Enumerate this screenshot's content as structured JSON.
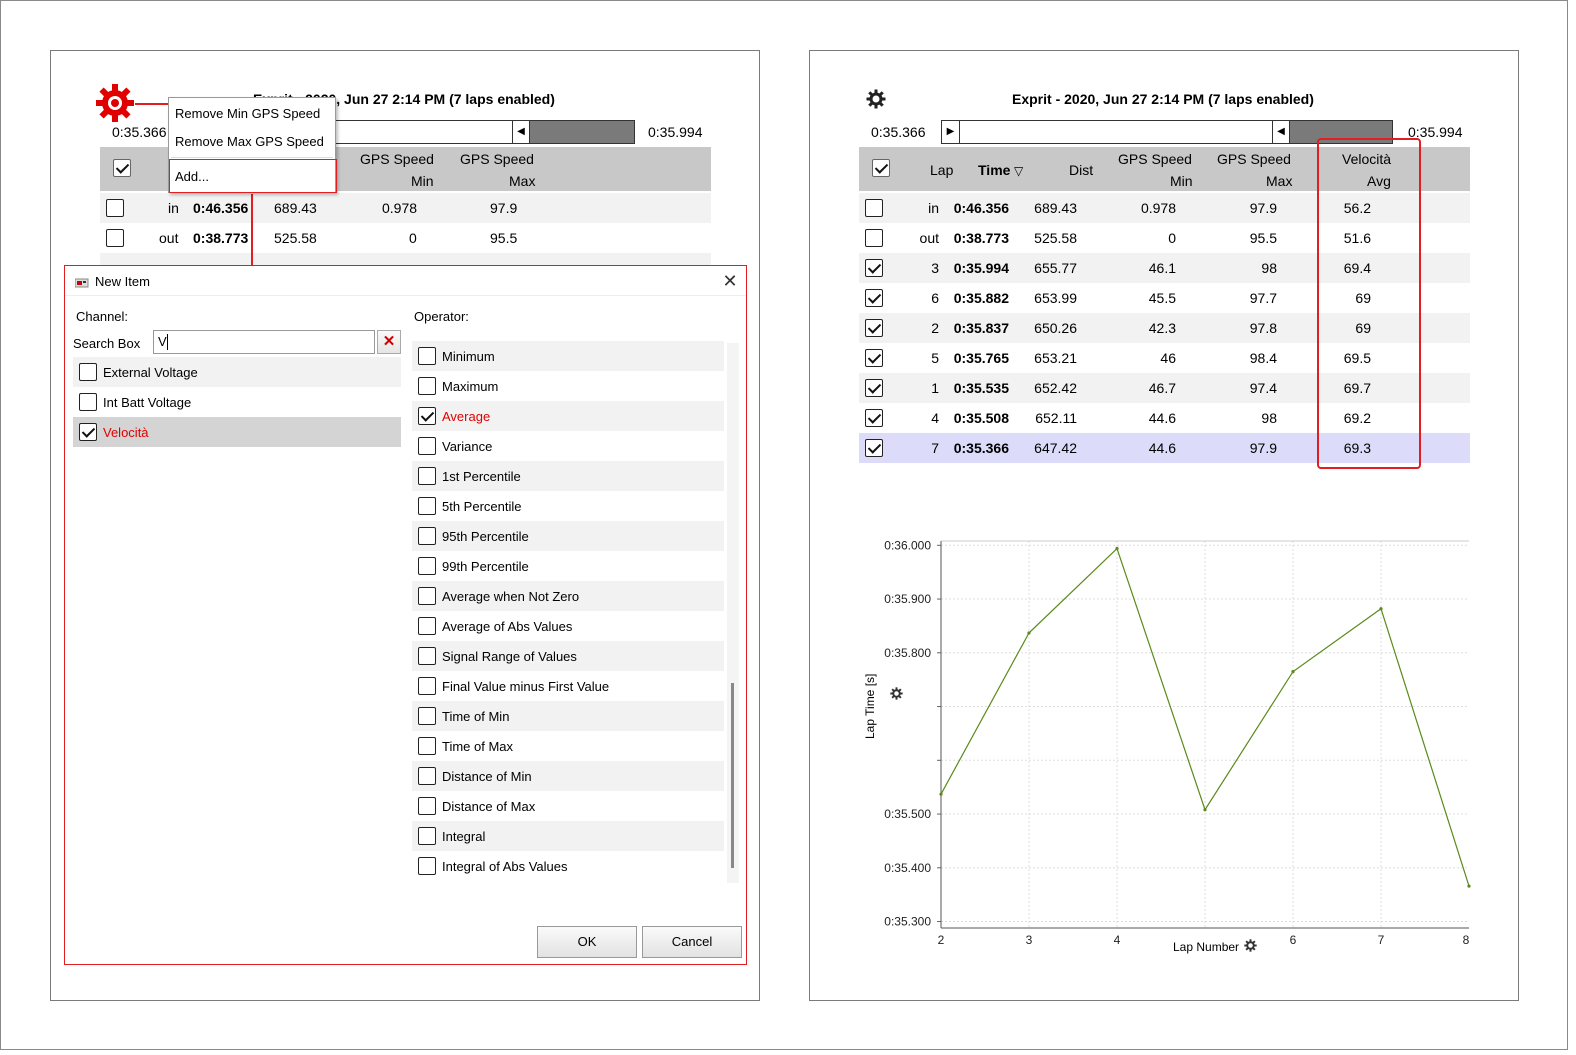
{
  "left": {
    "title": "Exprit - 2020, Jun 27 2:14 PM (7 laps enabled)",
    "slider_start": "0:35.366",
    "slider_end": "0:35.994",
    "header": {
      "gps1_top": "GPS Speed",
      "gps1_bottom": "Min",
      "gps2_top": "GPS Speed",
      "gps2_bottom": "Max"
    },
    "rows": [
      {
        "lap": "in",
        "time": "0:46.356",
        "dist": "689.43",
        "min": "0.978",
        "max": "97.9",
        "checked": false
      },
      {
        "lap": "out",
        "time": "0:38.773",
        "dist": "525.58",
        "min": "0",
        "max": "95.5",
        "checked": false
      }
    ],
    "context_menu": [
      "Remove Min GPS Speed",
      "Remove Max GPS Speed",
      "Add..."
    ]
  },
  "dialog": {
    "title": "New Item",
    "channel_label": "Channel:",
    "operator_label": "Operator:",
    "search_label": "Search Box",
    "search_value": "V",
    "channels": [
      {
        "label": "External Voltage",
        "checked": false
      },
      {
        "label": "Int Batt Voltage",
        "checked": false
      },
      {
        "label": "Velocità",
        "checked": true
      }
    ],
    "operators": [
      {
        "label": "Minimum",
        "checked": false
      },
      {
        "label": "Maximum",
        "checked": false
      },
      {
        "label": "Average",
        "checked": true
      },
      {
        "label": "Variance",
        "checked": false
      },
      {
        "label": "1st Percentile",
        "checked": false
      },
      {
        "label": "5th Percentile",
        "checked": false
      },
      {
        "label": "95th Percentile",
        "checked": false
      },
      {
        "label": "99th Percentile",
        "checked": false
      },
      {
        "label": "Average when Not Zero",
        "checked": false
      },
      {
        "label": "Average of Abs Values",
        "checked": false
      },
      {
        "label": "Signal Range of Values",
        "checked": false
      },
      {
        "label": "Final Value minus First Value",
        "checked": false
      },
      {
        "label": "Time of Min",
        "checked": false
      },
      {
        "label": "Time of Max",
        "checked": false
      },
      {
        "label": "Distance of Min",
        "checked": false
      },
      {
        "label": "Distance of Max",
        "checked": false
      },
      {
        "label": "Integral",
        "checked": false
      },
      {
        "label": "Integral of Abs Values",
        "checked": false
      }
    ],
    "ok_label": "OK",
    "cancel_label": "Cancel"
  },
  "right": {
    "title": "Exprit - 2020, Jun 27 2:14 PM (7 laps enabled)",
    "slider_start": "0:35.366",
    "slider_end": "0:35.994",
    "header": {
      "lap": "Lap",
      "time": "Time",
      "dist": "Dist",
      "gps1_top": "GPS Speed",
      "gps1_bottom": "Min",
      "gps2_top": "GPS Speed",
      "gps2_bottom": "Max",
      "vel_top": "Velocità",
      "vel_bottom": "Avg"
    },
    "rows": [
      {
        "lap": "in",
        "time": "0:46.356",
        "dist": "689.43",
        "min": "0.978",
        "max": "97.9",
        "avg": "56.2",
        "checked": false
      },
      {
        "lap": "out",
        "time": "0:38.773",
        "dist": "525.58",
        "min": "0",
        "max": "95.5",
        "avg": "51.6",
        "checked": false
      },
      {
        "lap": "3",
        "time": "0:35.994",
        "dist": "655.77",
        "min": "46.1",
        "max": "98",
        "avg": "69.4",
        "checked": true
      },
      {
        "lap": "6",
        "time": "0:35.882",
        "dist": "653.99",
        "min": "45.5",
        "max": "97.7",
        "avg": "69",
        "checked": true
      },
      {
        "lap": "2",
        "time": "0:35.837",
        "dist": "650.26",
        "min": "42.3",
        "max": "97.8",
        "avg": "69",
        "checked": true
      },
      {
        "lap": "5",
        "time": "0:35.765",
        "dist": "653.21",
        "min": "46",
        "max": "98.4",
        "avg": "69.5",
        "checked": true
      },
      {
        "lap": "1",
        "time": "0:35.535",
        "dist": "652.42",
        "min": "46.7",
        "max": "97.4",
        "avg": "69.7",
        "checked": true
      },
      {
        "lap": "4",
        "time": "0:35.508",
        "dist": "652.11",
        "min": "44.6",
        "max": "98",
        "avg": "69.2",
        "checked": true
      },
      {
        "lap": "7",
        "time": "0:35.366",
        "dist": "647.42",
        "min": "44.6",
        "max": "97.9",
        "avg": "69.3",
        "checked": true
      }
    ]
  },
  "chart_data": {
    "type": "line",
    "xlabel": "Lap Number",
    "ylabel": "Lap Time [s]",
    "x_ticks": [
      "2",
      "3",
      "4",
      "6",
      "7",
      "8"
    ],
    "y_ticks": [
      "0:36.000",
      "0:35.900",
      "0:35.800",
      "0:35.500",
      "0:35.400",
      "0:35.300"
    ],
    "ylim": [
      35.288,
      36.008
    ],
    "xlim": [
      2,
      8
    ],
    "color": "#5a8a1a",
    "x": [
      2,
      3,
      4,
      5,
      6,
      7,
      8
    ],
    "values": [
      35.537,
      35.837,
      35.994,
      35.508,
      35.765,
      35.882,
      35.366
    ]
  }
}
